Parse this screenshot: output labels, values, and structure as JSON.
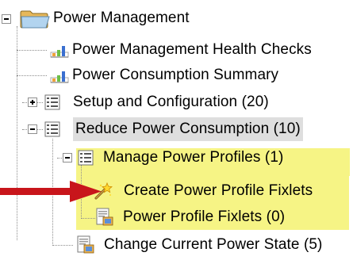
{
  "tree": {
    "items": [
      {
        "label": "Power Management",
        "icon": "folder-icon",
        "expanded": true
      },
      {
        "label": "Power Management Health Checks",
        "icon": "chart-icon"
      },
      {
        "label": "Power Consumption Summary",
        "icon": "chart-icon"
      },
      {
        "label": "Setup and Configuration (20)",
        "icon": "list-icon",
        "expanded": false
      },
      {
        "label": "Reduce Power Consumption (10)",
        "icon": "list-icon",
        "expanded": true,
        "selected": true
      },
      {
        "label": "Manage Power Profiles (1)",
        "icon": "list-icon",
        "expanded": true,
        "highlighted": true
      },
      {
        "label": "Create Power Profile Fixlets",
        "icon": "wizard-wand-icon",
        "highlighted": true
      },
      {
        "label": "Power Profile Fixlets (0)",
        "icon": "fixlet-document-icon",
        "highlighted": true
      },
      {
        "label": "Change Current Power State (5)",
        "icon": "fixlet-document-icon"
      }
    ]
  },
  "annotation": {
    "arrow_icon": "red-arrow-icon",
    "arrow_color": "#c8151b"
  },
  "colors": {
    "highlight": "#f6f485",
    "selected": "#dedede",
    "tree_lines": "#8e8e8e"
  }
}
